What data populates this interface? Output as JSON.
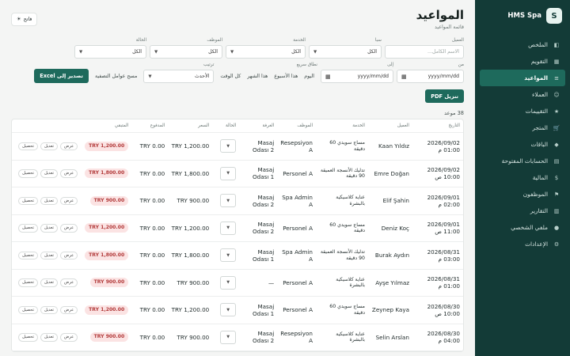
{
  "brand": {
    "logo": "S",
    "name": "HMS Spa"
  },
  "sidebar": {
    "items": [
      {
        "label": "الملخص",
        "icon": "◧",
        "name": "sidebar-item-summary",
        "active": false
      },
      {
        "label": "التقويم",
        "icon": "▦",
        "name": "sidebar-item-calendar",
        "active": false
      },
      {
        "label": "المواعيد",
        "icon": "≡",
        "name": "sidebar-item-appointments",
        "active": true
      },
      {
        "label": "العملاء",
        "icon": "☺",
        "name": "sidebar-item-clients",
        "active": false
      },
      {
        "label": "التقييمات",
        "icon": "★",
        "name": "sidebar-item-reviews",
        "active": false
      },
      {
        "label": "المتجر",
        "icon": "🛒",
        "name": "sidebar-item-store",
        "active": false
      },
      {
        "label": "الباقات",
        "icon": "◆",
        "name": "sidebar-item-packages",
        "active": false
      },
      {
        "label": "الحسابات المفتوحة",
        "icon": "▤",
        "name": "sidebar-item-open-accounts",
        "active": false
      },
      {
        "label": "المالية",
        "icon": "$",
        "name": "sidebar-item-finance",
        "active": false
      },
      {
        "label": "الموظفون",
        "icon": "⚑",
        "name": "sidebar-item-staff",
        "active": false
      },
      {
        "label": "التقارير",
        "icon": "▥",
        "name": "sidebar-item-reports",
        "active": false
      },
      {
        "label": "ملفي الشخصي",
        "icon": "●",
        "name": "sidebar-item-profile",
        "active": false
      },
      {
        "label": "الإعدادات",
        "icon": "⚙",
        "name": "sidebar-item-settings",
        "active": false
      }
    ]
  },
  "header": {
    "title": "المواعيد",
    "subtitle": "قائمة المواعيد",
    "theme_label": "فاتح",
    "theme_icon": "☀"
  },
  "filters": {
    "client_label": "العميل",
    "client_placeholder": "الاسم الكامل...",
    "room_label": "سبا",
    "room_value": "الكل",
    "service_label": "الخدمة",
    "service_value": "الكل",
    "employee_label": "الموظف",
    "employee_value": "الكل",
    "status_label": "الحالة",
    "status_value": "الكل",
    "from_label": "من",
    "from_value": "yyyy/mm/dd",
    "to_label": "إلى",
    "to_value": "yyyy/mm/dd",
    "quick_label": "نطاق سريع",
    "quick": [
      "اليوم",
      "هذا الأسبوع",
      "هذا الشهر",
      "كل الوقت"
    ],
    "sort_label": "ترتيب",
    "sort_value": "الأحدث",
    "clear_label": "مسح عوامل التصفية",
    "excel_label": "تصدير إلى Excel",
    "pdf_label": "تنزيل PDF"
  },
  "count_text": "38 موعد",
  "table": {
    "headers": [
      "التاريخ",
      "العميل",
      "الخدمة",
      "الموظف",
      "الغرفة",
      "الحالة",
      "السعر",
      "المدفوع",
      "المتبقي",
      ""
    ],
    "rows": [
      {
        "date": "2026/09/02",
        "time": "01:00 م",
        "client": "Kaan Yıldız",
        "service": "مساج سويدي 60 دقيقة",
        "employee": "Resepsiyon A",
        "room": "Masaj Odası 2",
        "price": "TRY 1,200.00",
        "paid": "TRY 0.00",
        "due": "TRY 1,200.00"
      },
      {
        "date": "2026/09/02",
        "time": "10:00 ص",
        "client": "Emre Doğan",
        "service": "تدليك الأنسجة العميقة 90 دقيقة",
        "employee": "Personel A",
        "room": "Masaj Odası 1",
        "price": "TRY 1,800.00",
        "paid": "TRY 0.00",
        "due": "TRY 1,800.00"
      },
      {
        "date": "2026/09/01",
        "time": "02:00 م",
        "client": "Elif Şahin",
        "service": "عناية كلاسيكية بالبشرة",
        "employee": "Spa Admin A",
        "room": "Masaj Odası 2",
        "price": "TRY 900.00",
        "paid": "TRY 0.00",
        "due": "TRY 900.00"
      },
      {
        "date": "2026/09/01",
        "time": "11:00 ص",
        "client": "Deniz Koç",
        "service": "مساج سويدي 60 دقيقة",
        "employee": "Personel A",
        "room": "Masaj Odası 2",
        "price": "TRY 1,200.00",
        "paid": "TRY 0.00",
        "due": "TRY 1,200.00"
      },
      {
        "date": "2026/08/31",
        "time": "03:00 م",
        "client": "Burak Aydın",
        "service": "تدليك الأنسجة العميقة 90 دقيقة",
        "employee": "Spa Admin A",
        "room": "Masaj Odası 1",
        "price": "TRY 1,800.00",
        "paid": "TRY 0.00",
        "due": "TRY 1,800.00"
      },
      {
        "date": "2026/08/31",
        "time": "01:00 م",
        "client": "Ayşe Yılmaz",
        "service": "عناية كلاسيكية بالبشرة",
        "employee": "Personel A",
        "room": "—",
        "price": "TRY 900.00",
        "paid": "TRY 0.00",
        "due": "TRY 900.00"
      },
      {
        "date": "2026/08/30",
        "time": "10:00 ص",
        "client": "Zeynep Kaya",
        "service": "مساج سويدي 60 دقيقة",
        "employee": "Personel A",
        "room": "Masaj Odası 1",
        "price": "TRY 1,200.00",
        "paid": "TRY 0.00",
        "due": "TRY 1,200.00"
      },
      {
        "date": "2026/08/30",
        "time": "04:00 م",
        "client": "Selin Arslan",
        "service": "عناية كلاسيكية بالبشرة",
        "employee": "Resepsiyon A",
        "room": "Masaj Odası 2",
        "price": "TRY 900.00",
        "paid": "TRY 0.00",
        "due": "TRY 900.00"
      }
    ],
    "actions": {
      "view": "عرض",
      "edit": "تعديل",
      "collect": "تحصيل"
    }
  },
  "colors": {
    "sidebar_bg": "#133b37",
    "accent": "#1e6a5c",
    "due_bg": "#fbe3e3",
    "due_text": "#b23a3a"
  }
}
